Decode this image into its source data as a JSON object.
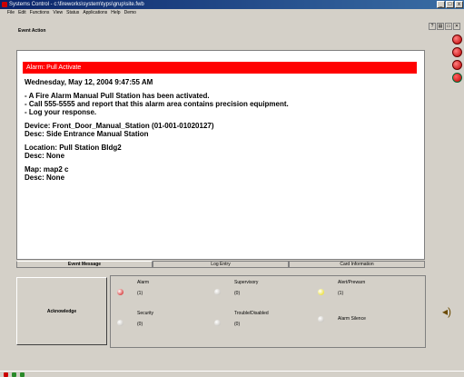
{
  "window": {
    "title": "Systems Control - c:\\fireworks\\system\\typs\\grup\\site.fwb"
  },
  "menu": [
    "File",
    "Edit",
    "Functions",
    "View",
    "Status",
    "Applications",
    "Help",
    "Demo"
  ],
  "window_buttons": [
    "_",
    "□",
    "x"
  ],
  "header": {
    "label": "Event Action"
  },
  "toolbar_icons": [
    "?",
    "▤",
    "▭",
    "✕"
  ],
  "alarm": {
    "banner": "Alarm: Pull Activate",
    "timestamp": "Wednesday, May 12, 2004 9:47:55 AM",
    "bullets": [
      "A Fire Alarm Manual Pull Station has been activated.",
      "Call 555-5555 and report that this alarm area contains  precision equipment.",
      "Log your response."
    ],
    "device": "Device: Front_Door_Manual_Station (01-001-01020127)",
    "device_desc": "Desc: Side Entrance Manual Station",
    "location": "Location: Pull Station Bldg2",
    "location_desc": "Desc: None",
    "map": "Map: map2 c",
    "map_desc": "Desc: None"
  },
  "tabs": [
    "Event Message",
    "Log Entry",
    "Card Information"
  ],
  "acknowledge": {
    "label": "Acknowledge"
  },
  "status_items": [
    {
      "label": "Alarm",
      "count": "(1)",
      "color": "#cc0000"
    },
    {
      "label": "Supervisory",
      "count": "(0)",
      "color": "#b8b4ac"
    },
    {
      "label": "Alert/Prewarn",
      "count": "(1)",
      "color": "#e6d800"
    },
    {
      "label": "Security",
      "count": "(0)",
      "color": "#b8b4ac"
    },
    {
      "label": "Trouble/Disabled",
      "count": "(0)",
      "color": "#b8b4ac"
    },
    {
      "label": "Alarm Silence",
      "count": "",
      "color": "#b8b4ac"
    }
  ],
  "colors": {
    "banner": "#ff0000",
    "panel_bg": "#ffffff",
    "chrome": "#d4d0c8"
  }
}
